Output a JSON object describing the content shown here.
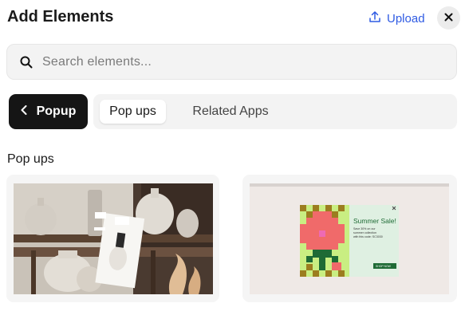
{
  "header": {
    "title": "Add Elements",
    "upload_label": "Upload"
  },
  "search": {
    "placeholder": "Search elements..."
  },
  "nav": {
    "back_label": "Popup",
    "tabs": [
      {
        "label": "Pop ups",
        "active": true
      },
      {
        "label": "Related Apps",
        "active": false
      }
    ]
  },
  "section": {
    "title": "Pop ups"
  },
  "cards": [
    {
      "kind": "vase-scene-popup-template"
    },
    {
      "kind": "summer-sale-popup-template",
      "popup_title": "Summer Sale!",
      "popup_body": [
        "Save 30% on our",
        "summer collection",
        "with this code: SC3030"
      ],
      "popup_button": "SHOP NOW"
    }
  ],
  "colors": {
    "accent": "#2f5be3",
    "dark_button": "#151515",
    "sale_green": "#1e6b35"
  }
}
